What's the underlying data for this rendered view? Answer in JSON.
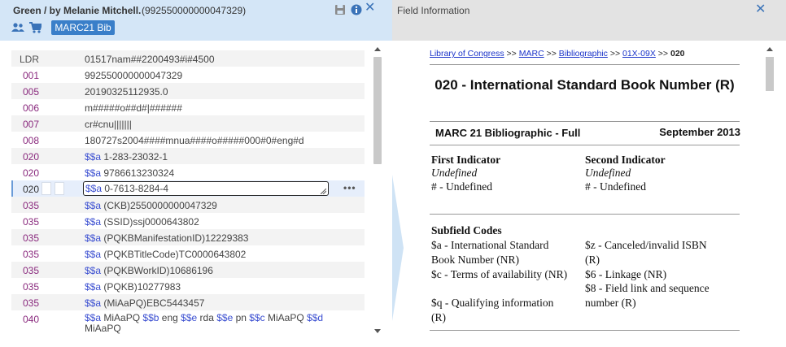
{
  "left_panel": {
    "title": "Green / by Melanie Mitchell.",
    "record_id": "(992550000000047329)",
    "badge": "MARC21 Bib",
    "icons": [
      "save-icon",
      "info-icon",
      "close-icon",
      "users-icon",
      "cart-icon"
    ],
    "rows": [
      {
        "tag": "LDR",
        "value": "01517nam##2200493#i#4500"
      },
      {
        "tag": "001",
        "value": "992550000000047329"
      },
      {
        "tag": "005",
        "value": "20190325112935.0"
      },
      {
        "tag": "006",
        "value": "m#####o##d#|######"
      },
      {
        "tag": "007",
        "value": "cr#cnu|||||||"
      },
      {
        "tag": "008",
        "value": "180727s2004####mnua####o#####000#0#eng#d"
      },
      {
        "tag": "020",
        "sub": "$$a",
        "value": "1-283-23032-1"
      },
      {
        "tag": "020",
        "sub": "$$a",
        "value": "9786613230324"
      },
      {
        "tag": "020",
        "sub": "$$a",
        "value": "0-7613-8284-4"
      },
      {
        "tag": "035",
        "sub": "$$a",
        "value": "(CKB)2550000000047329"
      },
      {
        "tag": "035",
        "sub": "$$a",
        "value": "(SSID)ssj0000643802"
      },
      {
        "tag": "035",
        "sub": "$$a",
        "value": "(PQKBManifestationID)12229383"
      },
      {
        "tag": "035",
        "sub": "$$a",
        "value": "(PQKBTitleCode)TC0000643802"
      },
      {
        "tag": "035",
        "sub": "$$a",
        "value": "(PQKBWorkID)10686196"
      },
      {
        "tag": "035",
        "sub": "$$a",
        "value": "(PQKB)10277983"
      },
      {
        "tag": "035",
        "sub": "$$a",
        "value": "(MiAaPQ)EBC5443457"
      }
    ],
    "row_040": {
      "tag": "040",
      "parts": [
        {
          "sub": "$$a",
          "text": "MiAaPQ"
        },
        {
          "sub": "$$b",
          "text": "eng"
        },
        {
          "sub": "$$e",
          "text": "rda"
        },
        {
          "sub": "$$e",
          "text": "pn"
        },
        {
          "sub": "$$c",
          "text": "MiAaPQ"
        },
        {
          "sub": "$$d",
          "text": "MiAaPQ"
        }
      ]
    },
    "more_label": "•••"
  },
  "right_panel": {
    "title": "Field Information",
    "breadcrumb": {
      "links": [
        "Library of Congress",
        "MARC",
        "Bibliographic",
        "01X-09X"
      ],
      "separator": ">>",
      "current": "020"
    },
    "doc_title": "020 - International Standard Book Number (R)",
    "edition": "MARC 21 Bibliographic - Full",
    "edition_date": "September 2013",
    "first_indicator": {
      "heading": "First Indicator",
      "status": "Undefined",
      "value": "# - Undefined"
    },
    "second_indicator": {
      "heading": "Second Indicator",
      "status": "Undefined",
      "value": "# - Undefined"
    },
    "subfield_heading": "Subfield Codes",
    "subfields_left": [
      "$a - International Standard Book Number (NR)",
      "$c - Terms of availability (NR)",
      "$q - Qualifying information (R)"
    ],
    "subfields_right": [
      "$z - Canceled/invalid ISBN (R)",
      "$6 - Linkage (NR)",
      "$8 - Field link and sequence number (R)"
    ]
  },
  "colors": {
    "left_header_bg": "#d4e6f7",
    "right_header_bg": "#e3e3e3",
    "tag_color": "#8a2a7e",
    "subfield_color": "#3b4fd1",
    "badge_bg": "#3a7fc9",
    "link_color": "#1a33c9"
  }
}
